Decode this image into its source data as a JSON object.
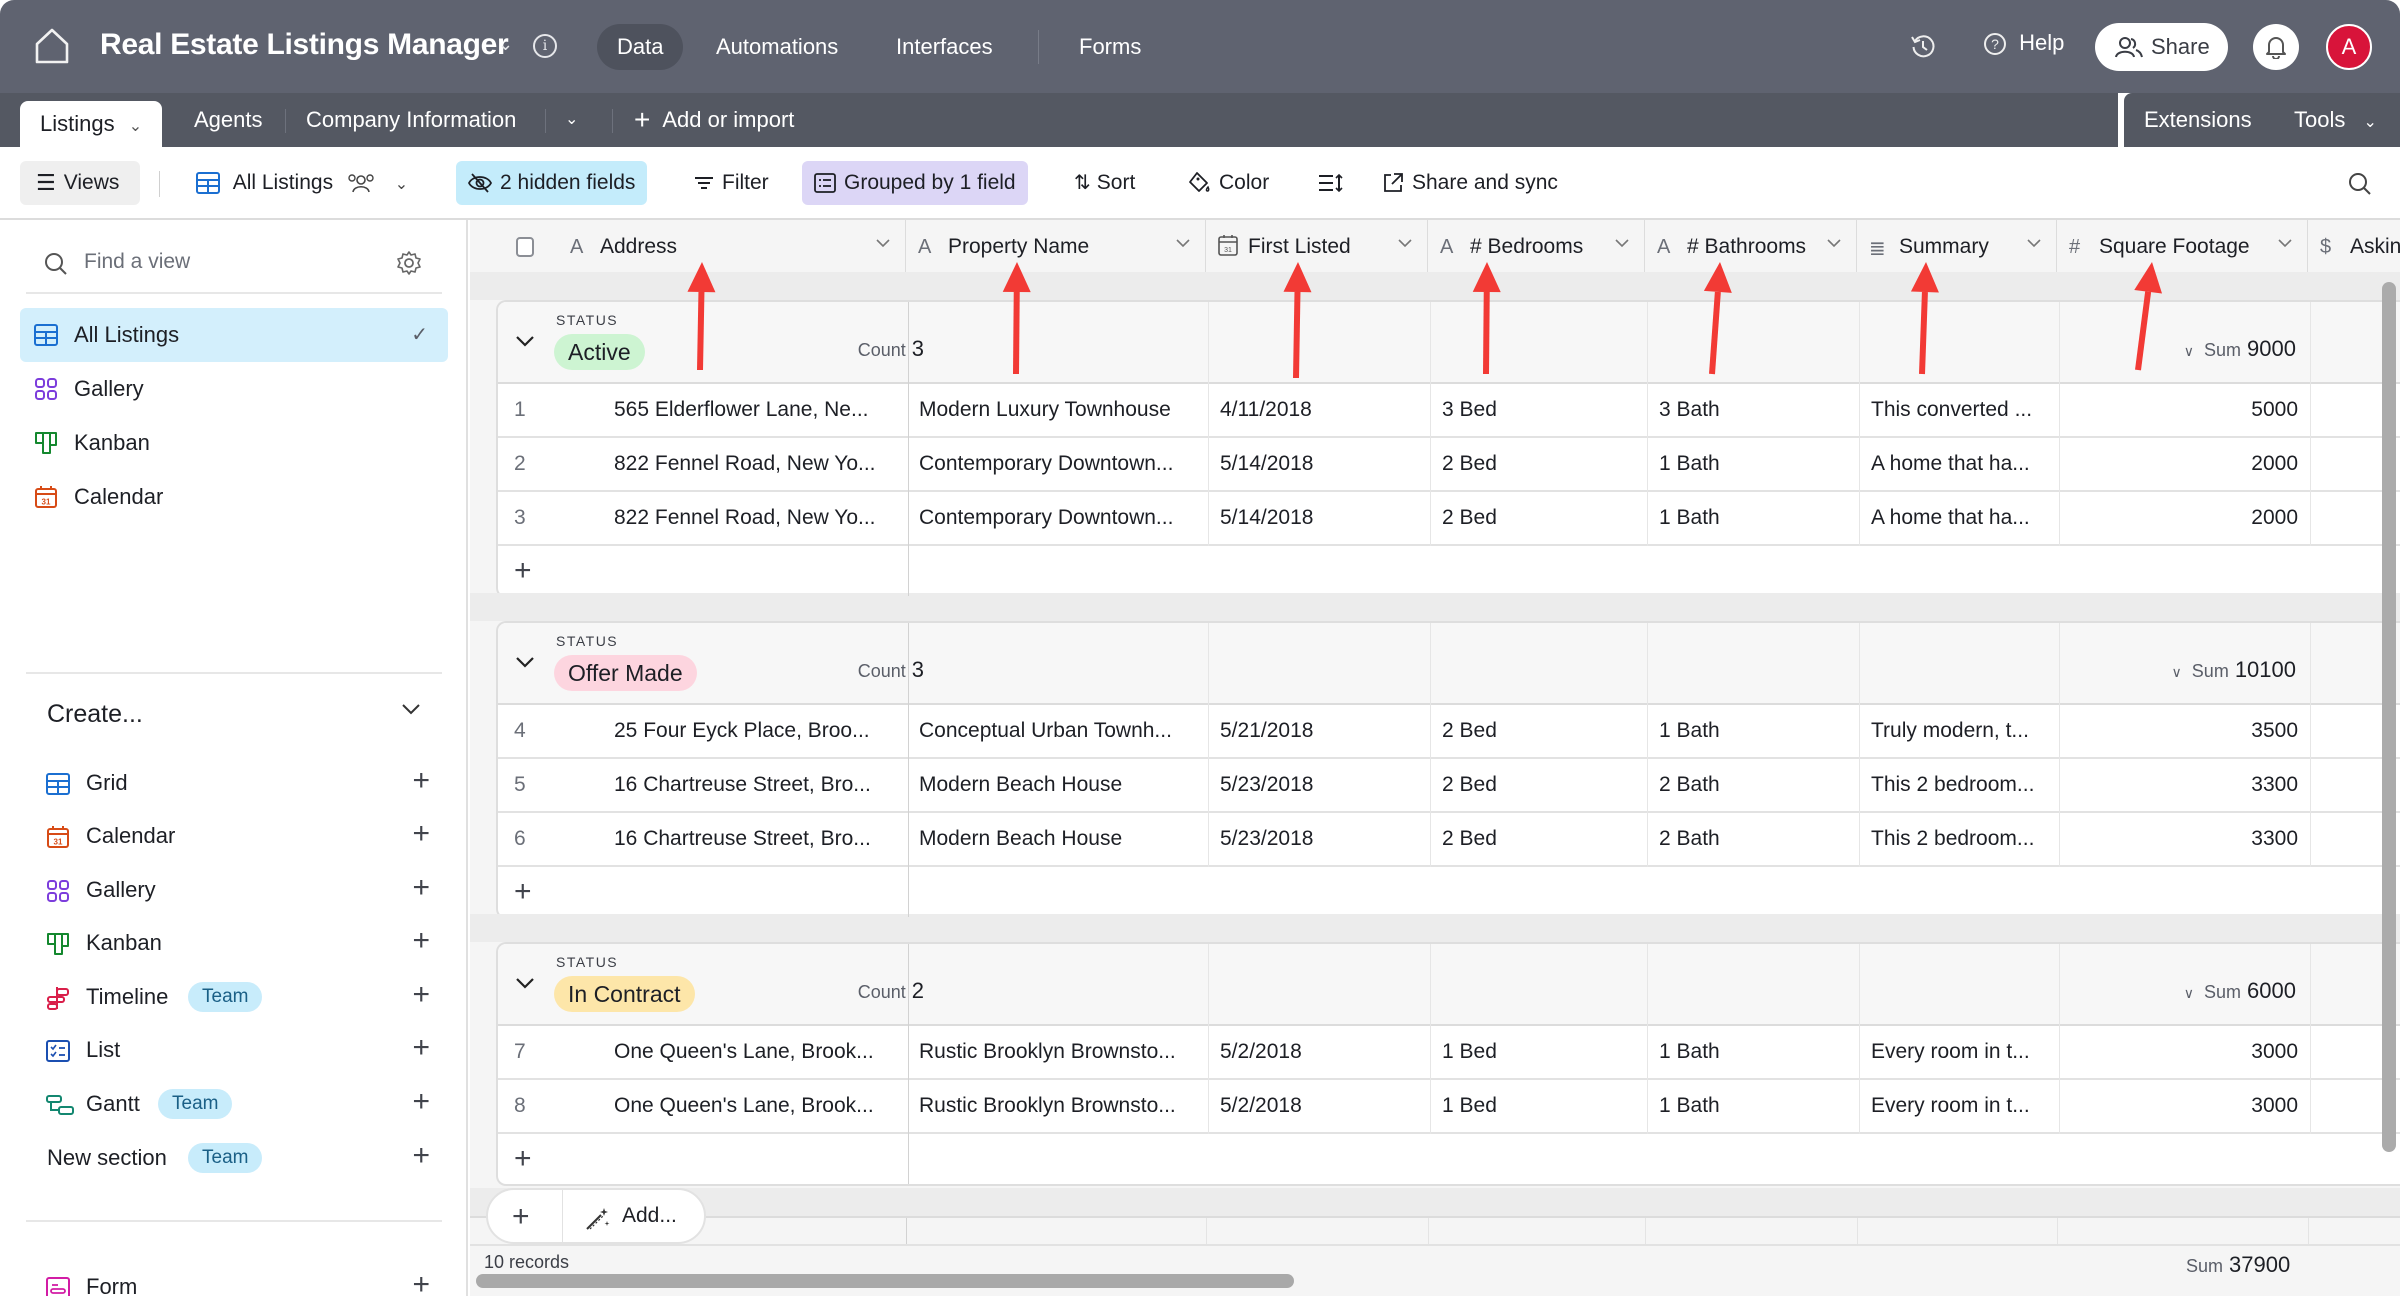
{
  "app": {
    "title": "Real Estate Listings Manager",
    "nav": [
      "Data",
      "Automations",
      "Interfaces",
      "Forms"
    ],
    "active_nav": "Data",
    "help_label": "Help",
    "share_label": "Share",
    "avatar_initial": "A",
    "colors": {
      "topbar": "#5f6370",
      "tabbar": "#545862",
      "avatar": "#d8143a",
      "arrow": "#f23a35"
    }
  },
  "tabs": {
    "items": [
      "Listings",
      "Agents",
      "Company Information"
    ],
    "active": "Listings",
    "add_label": "Add or import",
    "extensions_label": "Extensions",
    "tools_label": "Tools"
  },
  "toolbar": {
    "views_label": "Views",
    "view_name": "All Listings",
    "hidden_fields_label": "2 hidden fields",
    "filter_label": "Filter",
    "grouped_label": "Grouped by 1 field",
    "sort_label": "Sort",
    "color_label": "Color",
    "share_sync_label": "Share and sync"
  },
  "sidebar": {
    "find_placeholder": "Find a view",
    "views": [
      {
        "label": "All Listings",
        "icon": "grid-icon",
        "active": true
      },
      {
        "label": "Gallery",
        "icon": "gallery-icon"
      },
      {
        "label": "Kanban",
        "icon": "kanban-icon"
      },
      {
        "label": "Calendar",
        "icon": "calendar-icon"
      }
    ],
    "create_label": "Create...",
    "create_items": [
      {
        "label": "Grid",
        "icon": "grid-icon"
      },
      {
        "label": "Calendar",
        "icon": "calendar-icon"
      },
      {
        "label": "Gallery",
        "icon": "gallery-icon"
      },
      {
        "label": "Kanban",
        "icon": "kanban-icon"
      },
      {
        "label": "Timeline",
        "icon": "timeline-icon",
        "badge": "Team"
      },
      {
        "label": "List",
        "icon": "list-icon"
      },
      {
        "label": "Gantt",
        "icon": "gantt-icon",
        "badge": "Team"
      },
      {
        "label": "New section",
        "badge": "Team"
      },
      {
        "label": "Form",
        "icon": "form-icon"
      }
    ]
  },
  "grid": {
    "columns": [
      {
        "label": "Address",
        "icon": "text-field-icon"
      },
      {
        "label": "Property Name",
        "icon": "text-field-icon"
      },
      {
        "label": "First Listed",
        "icon": "date-field-icon"
      },
      {
        "label": "# Bedrooms",
        "icon": "text-field-icon"
      },
      {
        "label": "# Bathrooms",
        "icon": "text-field-icon"
      },
      {
        "label": "Summary",
        "icon": "long-text-field-icon"
      },
      {
        "label": "Square Footage",
        "icon": "number-field-icon"
      },
      {
        "label": "Askin",
        "icon": "currency-field-icon"
      }
    ],
    "group_field_label": "STATUS",
    "count_label": "Count",
    "sum_label": "Sum",
    "groups": [
      {
        "status": "Active",
        "color": "#cdf4d2",
        "count": "3",
        "sum": "9000",
        "rows": [
          [
            "1",
            "565 Elderflower Lane, Ne...",
            "Modern Luxury Townhouse",
            "4/11/2018",
            "3 Bed",
            "3 Bath",
            "This converted ...",
            "5000"
          ],
          [
            "2",
            "822 Fennel Road, New Yo...",
            "Contemporary Downtown...",
            "5/14/2018",
            "2 Bed",
            "1 Bath",
            "A home that ha...",
            "2000"
          ],
          [
            "3",
            "822 Fennel Road, New Yo...",
            "Contemporary Downtown...",
            "5/14/2018",
            "2 Bed",
            "1 Bath",
            "A home that ha...",
            "2000"
          ]
        ]
      },
      {
        "status": "Offer Made",
        "color": "#fdd5df",
        "count": "3",
        "sum": "10100",
        "rows": [
          [
            "4",
            "25 Four Eyck Place, Broo...",
            "Conceptual Urban Townh...",
            "5/21/2018",
            "2 Bed",
            "1 Bath",
            "Truly modern, t...",
            "3500"
          ],
          [
            "5",
            "16 Chartreuse Street, Bro...",
            "Modern Beach House",
            "5/23/2018",
            "2 Bed",
            "2 Bath",
            "This 2 bedroom...",
            "3300"
          ],
          [
            "6",
            "16 Chartreuse Street, Bro...",
            "Modern Beach House",
            "5/23/2018",
            "2 Bed",
            "2 Bath",
            "This 2 bedroom...",
            "3300"
          ]
        ]
      },
      {
        "status": "In Contract",
        "color": "#fde6a9",
        "count": "2",
        "sum": "6000",
        "rows": [
          [
            "7",
            "One Queen's Lane, Brook...",
            "Rustic Brooklyn Brownsto...",
            "5/2/2018",
            "1 Bed",
            "1 Bath",
            "Every room in t...",
            "3000"
          ],
          [
            "8",
            "One Queen's Lane, Brook...",
            "Rustic Brooklyn Brownsto...",
            "5/2/2018",
            "1 Bed",
            "1 Bath",
            "Every room in t...",
            "3000"
          ]
        ]
      }
    ],
    "add_label": "Add...",
    "records_label": "10 records",
    "total_sum": "37900"
  }
}
